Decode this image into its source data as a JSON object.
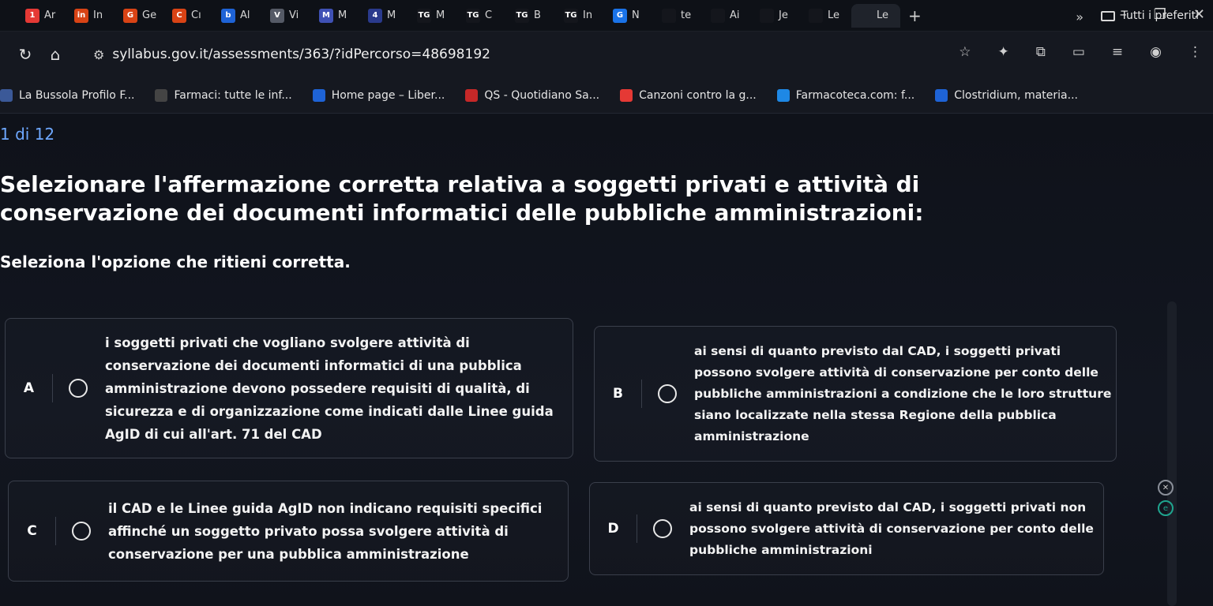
{
  "browser": {
    "tabs": [
      {
        "label": "Ar",
        "color": "#e53935",
        "glyph": "1"
      },
      {
        "label": "In",
        "color": "#d84315",
        "glyph": "in"
      },
      {
        "label": "Ge",
        "color": "#d84315",
        "glyph": "G"
      },
      {
        "label": "Cı",
        "color": "#d84315",
        "glyph": "C"
      },
      {
        "label": "Al",
        "color": "#1e63d6",
        "glyph": "b"
      },
      {
        "label": "Vi",
        "color": "#555a66",
        "glyph": "V"
      },
      {
        "label": "M",
        "color": "#3f51b5",
        "glyph": "M"
      },
      {
        "label": "M",
        "color": "#2a3a8c",
        "glyph": "4"
      },
      {
        "label": "M",
        "color": "#14161c",
        "glyph": "TG"
      },
      {
        "label": "C",
        "color": "#14161c",
        "glyph": "TG"
      },
      {
        "label": "B",
        "color": "#14161c",
        "glyph": "TG"
      },
      {
        "label": "In",
        "color": "#14161c",
        "glyph": "TG"
      },
      {
        "label": "N",
        "color": "#1a73e8",
        "glyph": "G"
      },
      {
        "label": "te",
        "color": "#14161c",
        "glyph": ""
      },
      {
        "label": "Ai",
        "color": "#14161c",
        "glyph": ""
      },
      {
        "label": "Je",
        "color": "#14161c",
        "glyph": ""
      },
      {
        "label": "Le",
        "color": "#14161c",
        "glyph": ""
      },
      {
        "label": "Le",
        "color": "#1f232b",
        "glyph": ""
      }
    ],
    "new_tab": "+",
    "window_controls": [
      "–",
      "❐",
      "✕"
    ],
    "url": "syllabus.gov.it/assessments/363/?idPercorso=48698192",
    "bookmarks": [
      {
        "label": "La Bussola Profilo F...",
        "color": "#3b5998"
      },
      {
        "label": "Farmaci: tutte le inf...",
        "color": "#444444"
      },
      {
        "label": "Home page – Liber...",
        "color": "#1e63d6"
      },
      {
        "label": "QS - Quotidiano Sa...",
        "color": "#c62828"
      },
      {
        "label": "Canzoni contro la g...",
        "color": "#e53935"
      },
      {
        "label": "Farmacoteca.com: f...",
        "color": "#1e88e5"
      },
      {
        "label": "Clostridium, materia...",
        "color": "#1e63d6"
      }
    ],
    "bookmarks_more": "»",
    "all_bookmarks": "Tutti i preferiti"
  },
  "quiz": {
    "counter": "1 di 12",
    "question": "Selezionare l'affermazione corretta relativa a soggetti privati e attività di conservazione dei documenti informatici delle pubbliche amministrazioni:",
    "instruction": "Seleziona l'opzione che ritieni corretta.",
    "options": [
      {
        "letter": "A",
        "text": "i soggetti privati che vogliano svolgere attività di conservazione dei documenti informatici di una pubblica amministrazione devono possedere requisiti di qualità, di sicurezza e di organizzazione come indicati dalle Linee guida AgID di cui all'art. 71 del CAD"
      },
      {
        "letter": "B",
        "text": "ai sensi di quanto previsto dal CAD, i soggetti privati possono svolgere attività di conservazione per conto delle pubbliche amministrazioni a condizione che le loro strutture siano localizzate nella stessa Regione della pubblica amministrazione"
      },
      {
        "letter": "C",
        "text": "il CAD e le Linee guida AgID non indicano requisiti specifici affinché un soggetto privato possa svolgere attività di conservazione per una pubblica amministrazione"
      },
      {
        "letter": "D",
        "text": "ai sensi di quanto previsto dal CAD, i soggetti privati non possono svolgere attività di conservazione per conto delle pubbliche amministrazioni"
      }
    ]
  }
}
